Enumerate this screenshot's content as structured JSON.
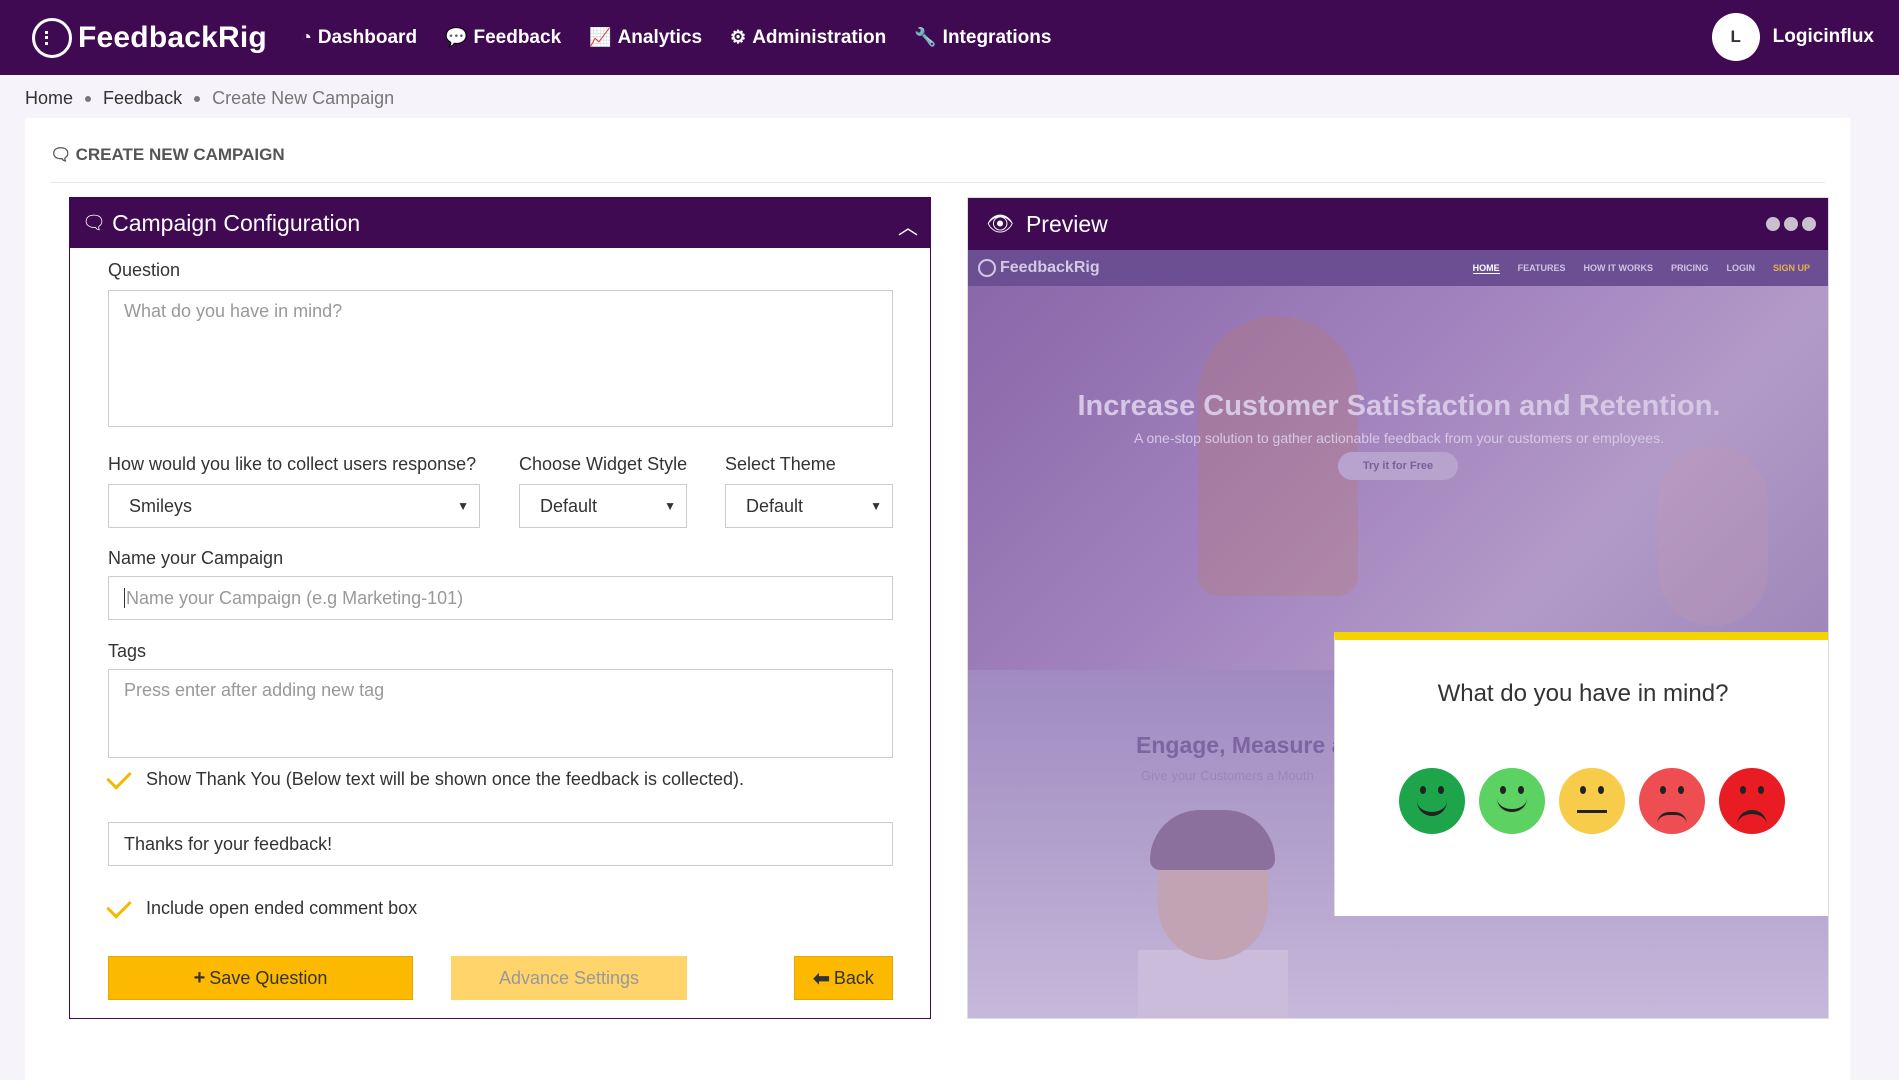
{
  "app": {
    "brand": "FeedbackRig",
    "nav": [
      {
        "label": "Dashboard",
        "icon": "dashboard-icon"
      },
      {
        "label": "Feedback",
        "icon": "comments-icon"
      },
      {
        "label": "Analytics",
        "icon": "line-chart-icon"
      },
      {
        "label": "Administration",
        "icon": "gears-icon"
      },
      {
        "label": "Integrations",
        "icon": "wrench-icon"
      }
    ],
    "user": {
      "initial": "L",
      "name": "Logicinflux"
    }
  },
  "breadcrumb": [
    "Home",
    "Feedback",
    "Create New Campaign"
  ],
  "page_title": "CREATE NEW CAMPAIGN",
  "config": {
    "title": "Campaign Configuration",
    "question_label": "Question",
    "question_placeholder": "What do you have in mind?",
    "collect_label": "How would you like to collect users response?",
    "collect_value": "Smileys",
    "widget_style_label": "Choose Widget Style",
    "widget_style_value": "Default",
    "theme_label": "Select Theme",
    "theme_value": "Default",
    "campaign_name_label": "Name your Campaign",
    "campaign_name_placeholder": "Name your Campaign (e.g Marketing-101)",
    "tags_label": "Tags",
    "tags_placeholder": "Press enter after adding new tag",
    "show_thank_you_label": "Show Thank You (Below text will be shown once the feedback is collected).",
    "thank_you_value": "Thanks for your feedback!",
    "comment_box_label": "Include open ended comment box",
    "save_button": "Save Question",
    "advance_button": "Advance Settings",
    "back_button": "Back"
  },
  "preview": {
    "title": "Preview",
    "site": {
      "logo": "FeedbackRig",
      "links": [
        "HOME",
        "FEATURES",
        "HOW IT WORKS",
        "PRICING",
        "LOGIN",
        "SIGN UP"
      ],
      "hero_title": "Increase Customer Satisfaction and Retention.",
      "hero_sub": "A one-stop solution to gather actionable feedback from your customers or employees.",
      "hero_button": "Try it for Free",
      "lower_title": "Engage, Measure a",
      "lower_sub": "Give your Customers a Mouth"
    },
    "widget_question": "What do you have in mind?",
    "smileys": [
      "very-happy",
      "happy",
      "neutral",
      "sad",
      "very-sad"
    ]
  },
  "colors": {
    "primary": "#3f0a52",
    "accent": "#fdb900"
  }
}
